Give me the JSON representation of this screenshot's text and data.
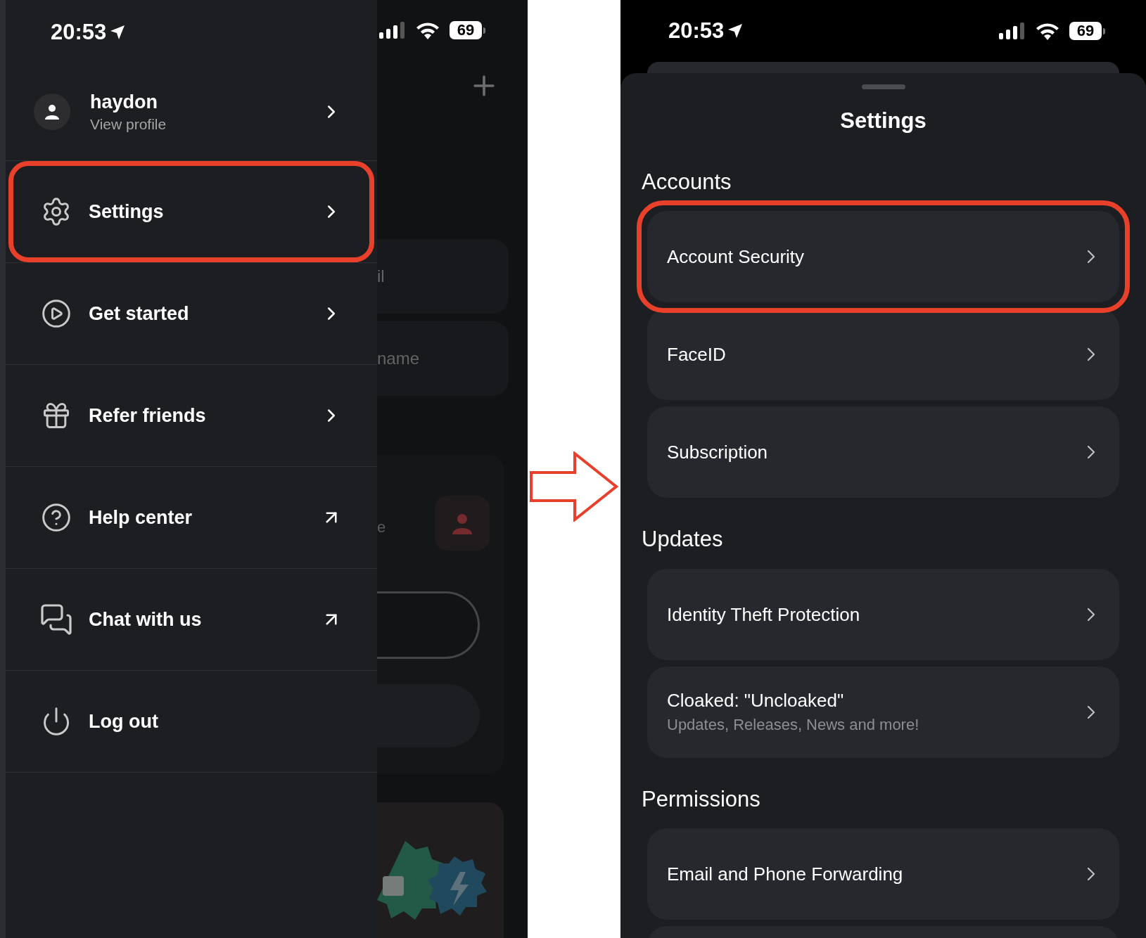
{
  "left_phone": {
    "status_bar": {
      "time": "20:53",
      "battery": "69"
    },
    "profile": {
      "name": "haydon",
      "subtitle": "View profile"
    },
    "menu_items": [
      {
        "label": "Settings",
        "kind": "internal",
        "highlighted": true
      },
      {
        "label": "Get started",
        "kind": "internal",
        "highlighted": false
      },
      {
        "label": "Refer friends",
        "kind": "internal",
        "highlighted": false
      },
      {
        "label": "Help center",
        "kind": "external",
        "highlighted": false
      },
      {
        "label": "Chat with us",
        "kind": "external",
        "highlighted": false
      },
      {
        "label": "Log out",
        "kind": "action",
        "highlighted": false
      }
    ],
    "background_texts": [
      "il",
      "name",
      "e"
    ]
  },
  "right_phone": {
    "status_bar": {
      "time": "20:53",
      "battery": "69"
    },
    "title": "Settings",
    "sections": [
      {
        "title": "Accounts",
        "rows": [
          {
            "label": "Account Security",
            "highlighted": true
          },
          {
            "label": "FaceID",
            "highlighted": false
          },
          {
            "label": "Subscription",
            "highlighted": false
          }
        ]
      },
      {
        "title": "Updates",
        "rows": [
          {
            "label": "Identity Theft Protection",
            "highlighted": false
          },
          {
            "label": "Cloaked: \"Uncloaked\"",
            "subtitle": "Updates, Releases, News and more!",
            "highlighted": false
          }
        ]
      },
      {
        "title": "Permissions",
        "rows": [
          {
            "label": "Email and Phone Forwarding",
            "highlighted": false
          }
        ]
      }
    ]
  }
}
